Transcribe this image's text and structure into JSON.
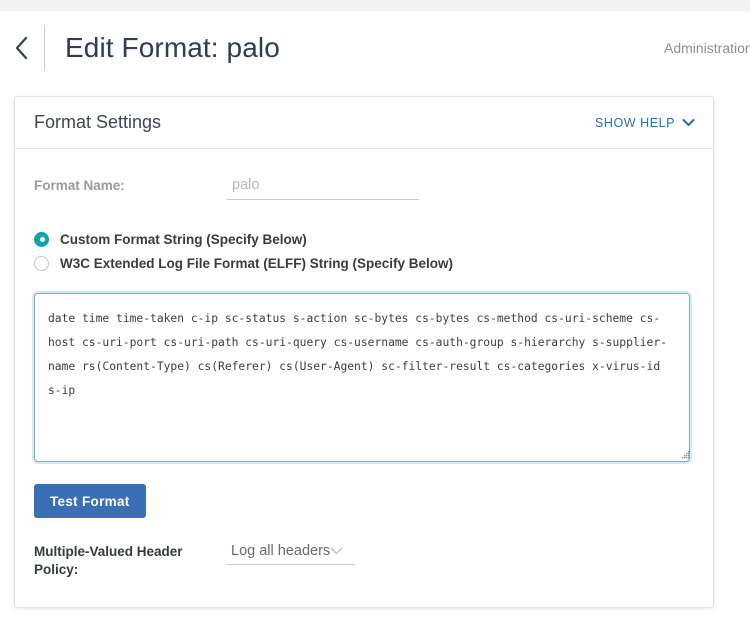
{
  "header": {
    "back_icon": "chevron-left-icon",
    "title": "Edit Format: palo",
    "right_text": "Administration"
  },
  "card": {
    "title": "Format Settings",
    "show_help_label": "SHOW HELP",
    "show_help_icon": "chevron-down-icon"
  },
  "form": {
    "name_label": "Format Name:",
    "name_value": "palo",
    "name_placeholder": "palo",
    "radios": [
      {
        "label": "Custom Format String (Specify Below)",
        "checked": true
      },
      {
        "label": "W3C Extended Log File Format (ELFF) String (Specify Below)",
        "checked": false
      }
    ],
    "format_string": "date time time-taken c-ip sc-status s-action sc-bytes cs-bytes cs-method cs-uri-scheme cs-host cs-uri-port cs-uri-path cs-uri-query cs-username cs-auth-group s-hierarchy s-supplier-name rs(Content-Type) cs(Referer) cs(User-Agent) sc-filter-result cs-categories x-virus-id s-ip",
    "test_button_label": "Test Format",
    "policy_label": "Multiple-Valued Header Policy:",
    "policy_value": "Log all headers",
    "policy_chevron_icon": "chevron-down-icon"
  },
  "colors": {
    "accent_teal": "#11a2b3",
    "link_blue": "#2a6ebb",
    "button_blue": "#3a6eb5",
    "focus_border": "#75b3d6",
    "page_background": "#ffffff",
    "strip_gray": "#f2f2f3"
  }
}
